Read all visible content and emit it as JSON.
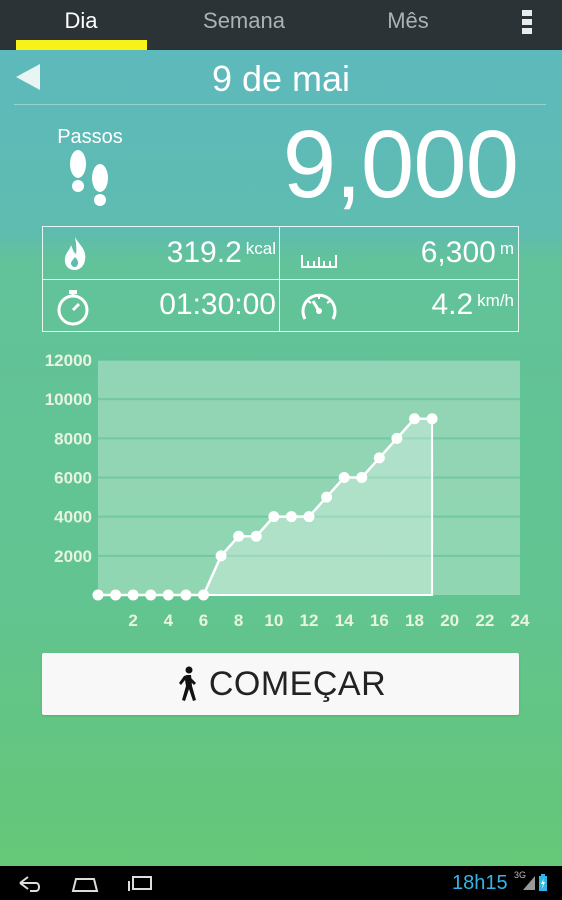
{
  "tabs": [
    {
      "label": "Dia",
      "active": true
    },
    {
      "label": "Semana",
      "active": false
    },
    {
      "label": "Mês",
      "active": false
    }
  ],
  "header": {
    "date": "9 de mai"
  },
  "steps": {
    "label": "Passos",
    "value": "9,000"
  },
  "stats": {
    "calories": {
      "value": "319.2",
      "unit": "kcal",
      "icon": "flame-icon"
    },
    "distance": {
      "value": "6,300",
      "unit": "m",
      "icon": "ruler-icon"
    },
    "duration": {
      "value": "01:30:00",
      "icon": "stopwatch-icon"
    },
    "speed": {
      "value": "4.2",
      "unit": "km/h",
      "icon": "speedometer-icon"
    }
  },
  "start_button": {
    "label": "COMEÇAR",
    "icon": "walking-person-icon"
  },
  "status_bar": {
    "time": "18h15",
    "network": "3G"
  },
  "colors": {
    "accent": "#f6f21a",
    "tabbar": "#2b3336",
    "clock": "#33b5e5",
    "label": "#e8f4e0"
  },
  "chart_data": {
    "type": "area",
    "title": "",
    "xlabel": "",
    "ylabel": "",
    "x": [
      0,
      1,
      2,
      3,
      4,
      5,
      6,
      7,
      8,
      9,
      10,
      11,
      12,
      13,
      14,
      15,
      16,
      17,
      18,
      19
    ],
    "y": [
      0,
      0,
      0,
      0,
      0,
      0,
      0,
      2000,
      3000,
      3000,
      4000,
      4000,
      4000,
      5000,
      6000,
      6000,
      7000,
      8000,
      9000,
      9000
    ],
    "xlim": [
      0,
      24
    ],
    "ylim": [
      0,
      12000
    ],
    "x_ticks": [
      "2",
      "4",
      "6",
      "8",
      "10",
      "12",
      "14",
      "16",
      "18",
      "20",
      "22",
      "24"
    ],
    "y_ticks": [
      "2000",
      "4000",
      "6000",
      "8000",
      "10000",
      "12000"
    ],
    "grid": true
  }
}
